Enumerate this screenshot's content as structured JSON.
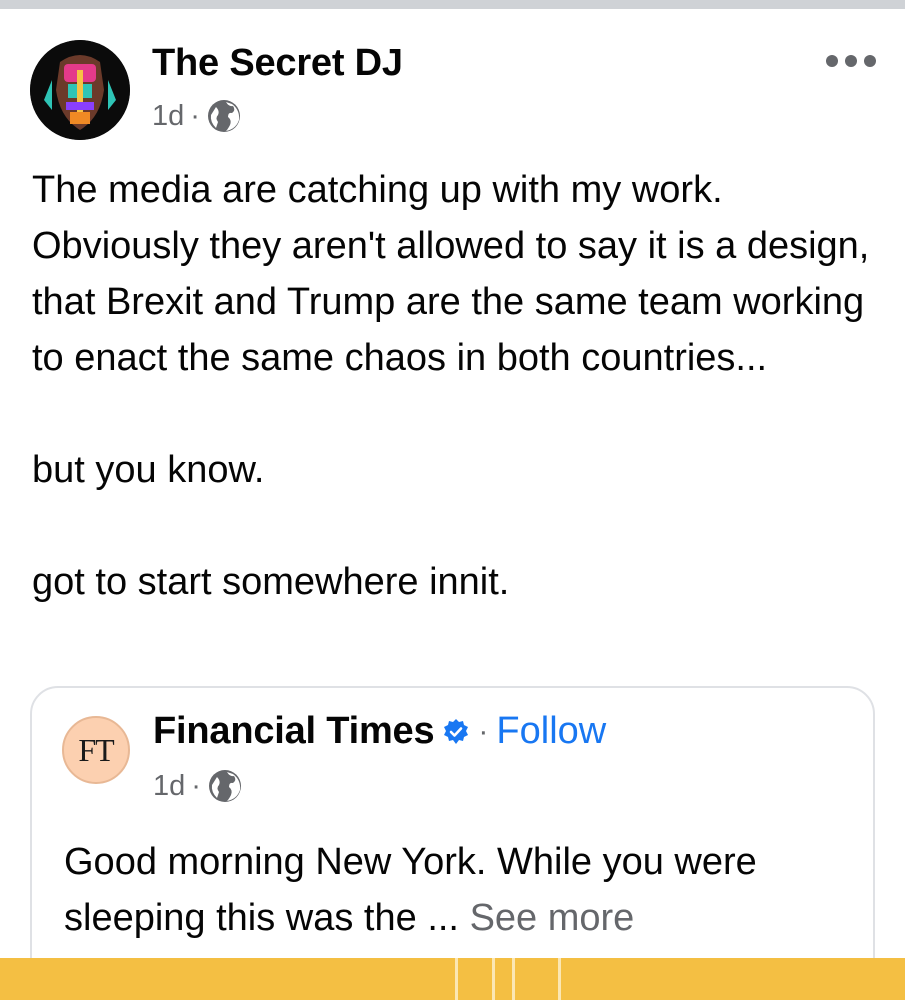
{
  "post": {
    "author": "The Secret DJ",
    "time": "1d",
    "separator": "·",
    "paragraphs": [
      "The media are catching up with my work. Obviously they aren't allowed to say it is a design, that Brexit and Trump are the same team working to enact the same chaos in both countries...",
      "but you know.",
      "got to start somewhere innit."
    ]
  },
  "shared": {
    "logo_text": "FT",
    "name": "Financial Times",
    "follow_label": "Follow",
    "separator": "·",
    "time": "1d",
    "text": "Good morning New York. While you were sleeping this was the ... ",
    "see_more": "See more"
  },
  "icons": {
    "audience": "globe-icon",
    "verified": "verified-badge-icon",
    "more": "more-options-icon"
  },
  "colors": {
    "link": "#1877f2",
    "meta": "#65676b",
    "ft_logo_bg": "#fcd0b0",
    "preview_bg": "#f4bf43"
  }
}
